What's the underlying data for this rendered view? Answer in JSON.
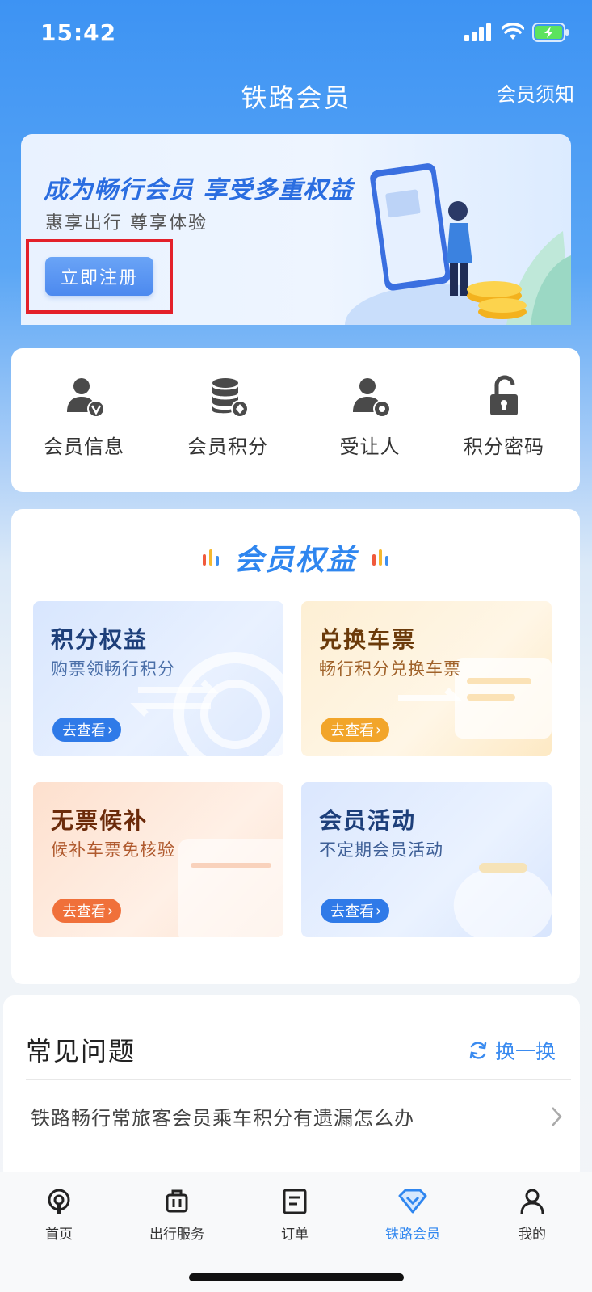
{
  "status_bar": {
    "time": "15:42"
  },
  "header": {
    "title": "铁路会员",
    "right_link": "会员须知"
  },
  "banner": {
    "title": "成为畅行会员 享受多重权益",
    "subtitle": "惠享出行 尊享体验",
    "register_label": "立即注册"
  },
  "quick_menu": {
    "items": [
      {
        "label": "会员信息",
        "icon": "member-info-icon"
      },
      {
        "label": "会员积分",
        "icon": "member-points-icon"
      },
      {
        "label": "受让人",
        "icon": "transferee-icon"
      },
      {
        "label": "积分密码",
        "icon": "points-password-lock-icon"
      }
    ]
  },
  "benefits": {
    "title": "会员权益",
    "tiles": [
      {
        "title": "积分权益",
        "subtitle": "购票领畅行积分",
        "button": "去查看"
      },
      {
        "title": "兑换车票",
        "subtitle": "畅行积分兑换车票",
        "button": "去查看"
      },
      {
        "title": "无票候补",
        "subtitle": "候补车票免核验",
        "button": "去查看"
      },
      {
        "title": "会员活动",
        "subtitle": "不定期会员活动",
        "button": "去查看"
      }
    ],
    "tile_colors": {
      "blue": "#2f7ae8",
      "gold": "#f2a52a",
      "orange": "#f0703a"
    }
  },
  "faq": {
    "title": "常见问题",
    "refresh_label": "换一换",
    "questions": [
      "铁路畅行常旅客会员乘车积分有遗漏怎么办"
    ]
  },
  "tab_bar": {
    "items": [
      {
        "label": "首页",
        "icon": "home-train-icon"
      },
      {
        "label": "出行服务",
        "icon": "luggage-icon"
      },
      {
        "label": "订单",
        "icon": "order-list-icon"
      },
      {
        "label": "铁路会员",
        "icon": "diamond-icon",
        "active": true
      },
      {
        "label": "我的",
        "icon": "person-icon"
      }
    ]
  },
  "colors": {
    "accent": "#2f86ef",
    "highlight_border": "#e3202a"
  }
}
